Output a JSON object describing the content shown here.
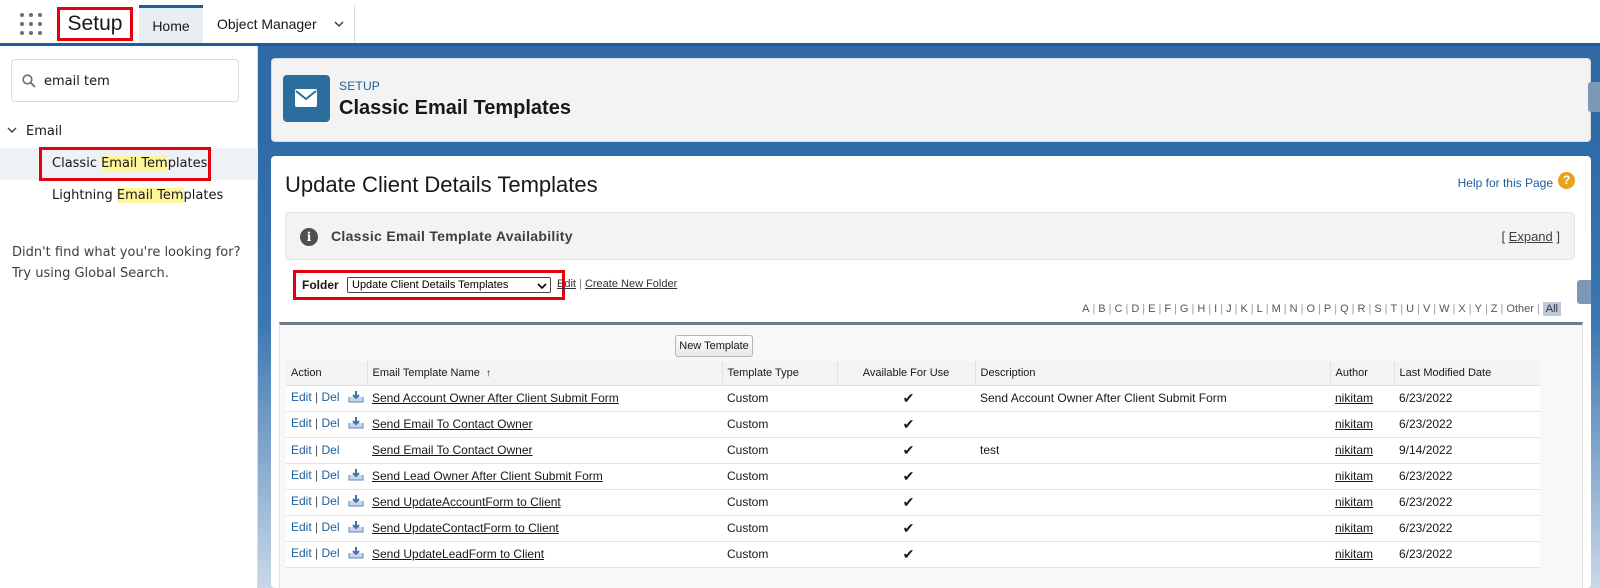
{
  "topbar": {
    "app_title": "Setup",
    "tabs": [
      {
        "label": "Home"
      },
      {
        "label": "Object Manager"
      }
    ]
  },
  "sidebar": {
    "search_value": "email tem",
    "tree_root": "Email",
    "items": [
      {
        "pre": "Classic ",
        "match": "Email Tem",
        "post": "plates"
      },
      {
        "pre": "Lightning ",
        "match": "Email Tem",
        "post": "plates"
      }
    ],
    "not_found_line1": "Didn't find what you're looking for?",
    "not_found_line2": "Try using Global Search."
  },
  "header": {
    "sub": "SETUP",
    "title": "Classic Email Templates"
  },
  "page": {
    "title": "Update Client Details Templates",
    "help_link": "Help for this Page",
    "help_icon": "?",
    "availability_title": "Classic Email Template Availability",
    "expand_label": "Expand",
    "folder_label": "Folder",
    "folder_value": "Update Client Details Templates",
    "edit_link": "Edit",
    "create_folder_link": "Create New Folder",
    "alphabet": [
      "A",
      "B",
      "C",
      "D",
      "E",
      "F",
      "G",
      "H",
      "I",
      "J",
      "K",
      "L",
      "M",
      "N",
      "O",
      "P",
      "Q",
      "R",
      "S",
      "T",
      "U",
      "V",
      "W",
      "X",
      "Y",
      "Z",
      "Other",
      "All"
    ],
    "new_template_button": "New Template"
  },
  "table": {
    "columns": [
      "Action",
      "Email Template Name",
      "Template Type",
      "Available For Use",
      "Description",
      "Author",
      "Last Modified Date"
    ],
    "sort_indicator": "↑",
    "edit_label": "Edit",
    "del_label": "Del",
    "rows": [
      {
        "name": "Send Account Owner After Client Submit Form",
        "type": "Custom",
        "available": "✔",
        "description": "Send Account Owner After Client Submit Form",
        "author": "nikitam",
        "date": "6/23/2022",
        "download": true
      },
      {
        "name": "Send Email To Contact Owner",
        "type": "Custom",
        "available": "✔",
        "description": "",
        "author": "nikitam",
        "date": "6/23/2022",
        "download": true
      },
      {
        "name": "Send Email To Contact Owner",
        "type": "Custom",
        "available": "✔",
        "description": "test",
        "author": "nikitam",
        "date": "9/14/2022",
        "download": false
      },
      {
        "name": "Send Lead Owner After Client Submit Form",
        "type": "Custom",
        "available": "✔",
        "description": "",
        "author": "nikitam",
        "date": "6/23/2022",
        "download": true
      },
      {
        "name": "Send UpdateAccountForm to Client",
        "type": "Custom",
        "available": "✔",
        "description": "",
        "author": "nikitam",
        "date": "6/23/2022",
        "download": true
      },
      {
        "name": "Send UpdateContactForm to Client",
        "type": "Custom",
        "available": "✔",
        "description": "",
        "author": "nikitam",
        "date": "6/23/2022",
        "download": true
      },
      {
        "name": "Send UpdateLeadForm to Client",
        "type": "Custom",
        "available": "✔",
        "description": "",
        "author": "nikitam",
        "date": "6/23/2022",
        "download": true
      }
    ]
  },
  "colors": {
    "brand_blue": "#1b5f9e",
    "highlight_red": "#e3000f",
    "match_yellow": "#fff59a"
  }
}
